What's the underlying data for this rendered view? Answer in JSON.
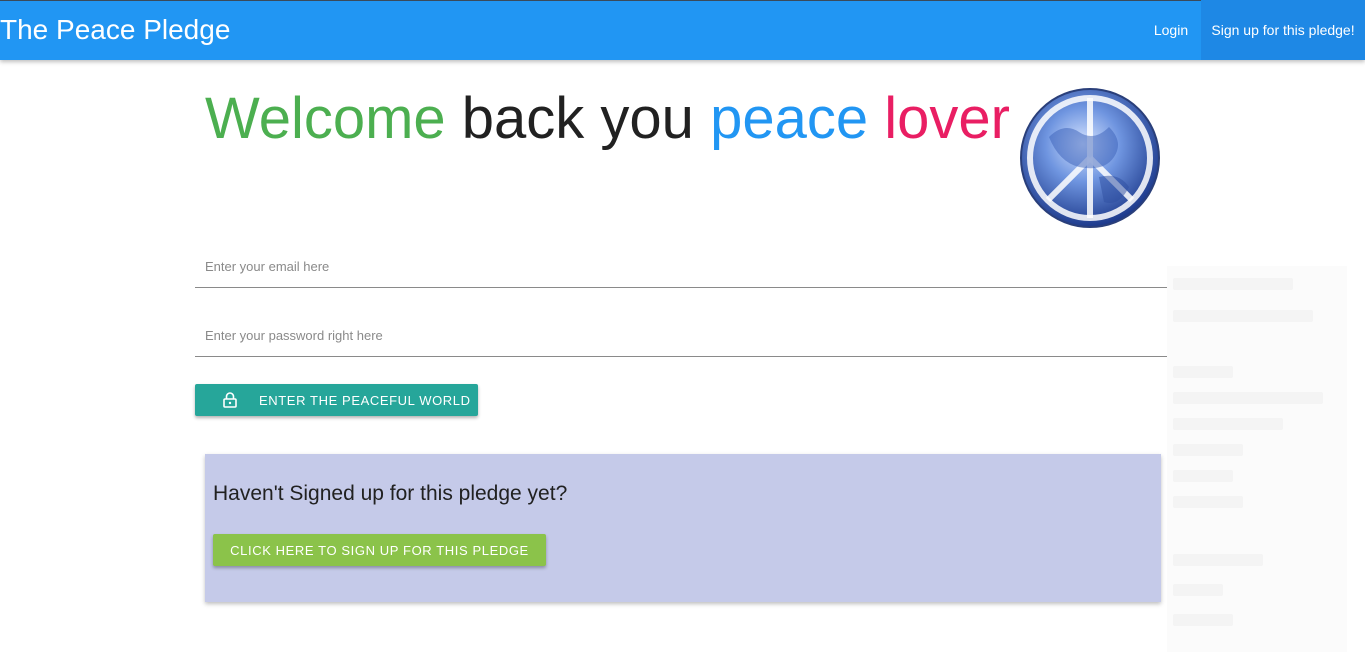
{
  "navbar": {
    "brand": "The Peace Pledge",
    "login_label": "Login",
    "signup_label": "Sign up for this pledge!"
  },
  "welcome": {
    "word1": "Welcome",
    "word2": "back you",
    "word3": "peace",
    "word4": "lover"
  },
  "form": {
    "email_placeholder": "Enter your email here",
    "password_placeholder": "Enter your password right here",
    "enter_button_label": "ENTER THE PEACEFUL WORLD"
  },
  "signup_card": {
    "question": "Haven't Signed up for this pledge yet?",
    "button_label": "CLICK HERE TO SIGN UP FOR THIS PLEDGE"
  },
  "colors": {
    "navbar": "#2196f3",
    "welcome_green": "#4caf50",
    "peace_blue": "#2196f3",
    "lover_pink": "#e91e63",
    "enter_button": "#26a69a",
    "signup_card_bg": "#c5cae9",
    "signup_button": "#8bc34a"
  },
  "icons": {
    "globe": "peace-globe-icon",
    "lock": "lock-icon"
  }
}
